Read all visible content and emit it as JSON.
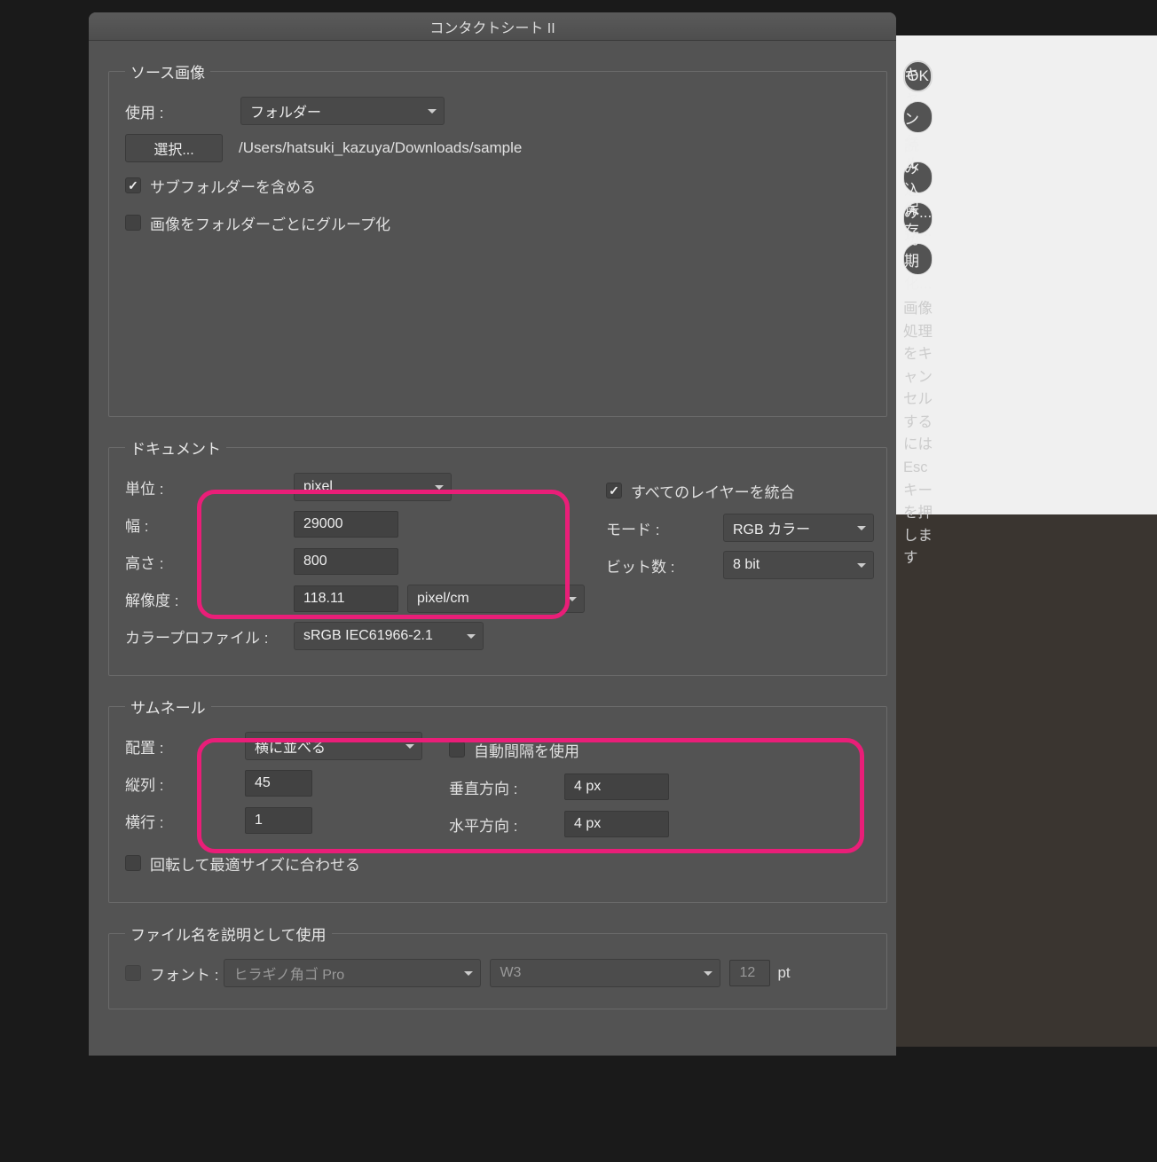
{
  "title": "コンタクトシート II",
  "source": {
    "legend": "ソース画像",
    "use_label": "使用 :",
    "use_value": "フォルダー",
    "select_button": "選択...",
    "path": "/Users/hatsuki_kazuya/Downloads/sample",
    "include_subfolders": "サブフォルダーを含める",
    "group_by_folder": "画像をフォルダーごとにグループ化"
  },
  "document": {
    "legend": "ドキュメント",
    "unit_label": "単位 :",
    "unit_value": "pixel",
    "width_label": "幅 :",
    "width_value": "29000",
    "height_label": "高さ :",
    "height_value": "800",
    "resolution_label": "解像度 :",
    "resolution_value": "118.11",
    "resolution_unit": "pixel/cm",
    "profile_label": "カラープロファイル :",
    "profile_value": "sRGB IEC61966-2.1",
    "flatten_label": "すべてのレイヤーを統合",
    "mode_label": "モード :",
    "mode_value": "RGB カラー",
    "bits_label": "ビット数 :",
    "bits_value": "8 bit"
  },
  "thumbnail": {
    "legend": "サムネール",
    "place_label": "配置 :",
    "place_value": "横に並べる",
    "columns_label": "縦列 :",
    "columns_value": "45",
    "rows_label": "横行 :",
    "rows_value": "1",
    "auto_spacing": "自動間隔を使用",
    "vertical_label": "垂直方向 :",
    "vertical_value": "4 px",
    "horizontal_label": "水平方向 :",
    "horizontal_value": "4 px",
    "rotate_label": "回転して最適サイズに合わせる"
  },
  "caption": {
    "legend": "ファイル名を説明として使用",
    "font_label": "フォント :",
    "font_value": "ヒラギノ角ゴ Pro",
    "weight_value": "W3",
    "size_value": "12",
    "size_unit": "pt"
  },
  "sidebar": {
    "ok": "OK",
    "cancel": "キャンセル",
    "load": "読み込み...",
    "save": "保存...",
    "reset": "初期化...",
    "hint": "画像処理をキャンセルするには Esc キーを押します"
  }
}
